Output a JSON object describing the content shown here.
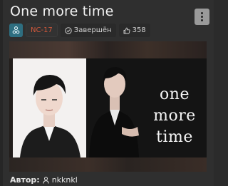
{
  "fic": {
    "title": "One more time",
    "rating": "NC-17",
    "status": "Завершён",
    "likes": "358",
    "author_label": "Автор:",
    "author_name": "nkknkl"
  },
  "cover": {
    "text_line1": "one",
    "text_line2": "more",
    "text_line3": "time"
  },
  "icons": {
    "direction": "pair-users-icon",
    "status": "check-circle-icon",
    "likes": "thumbs-up-icon",
    "author": "user-icon",
    "menu": "more-vertical-icon"
  },
  "colors": {
    "direction_badge": "#2e6e80",
    "rating_text": "#d2583b",
    "menu_button": "#9a9a9a"
  }
}
